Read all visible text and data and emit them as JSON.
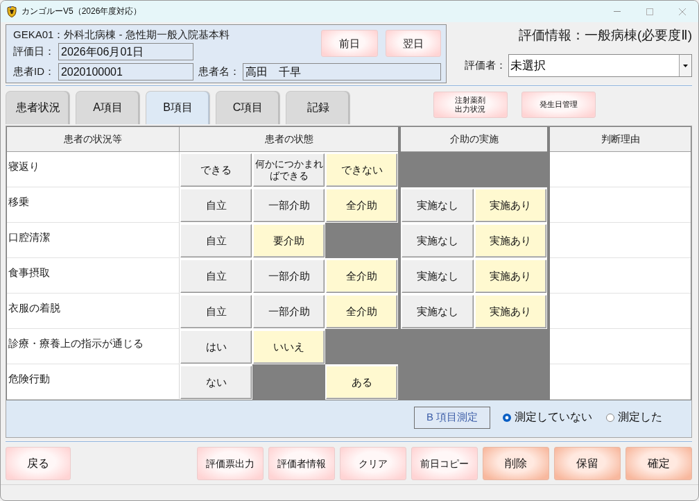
{
  "window": {
    "title": "カンゴルーV5（2026年度対応）"
  },
  "header": {
    "ward": "GEKA01：外科北病棟 - 急性期一般入院基本料",
    "evaluation_date": {
      "label": "評価日：",
      "value": "2026年06月01日"
    },
    "patient_id": {
      "label": "患者ID：",
      "value": "2020100001"
    },
    "patient_name": {
      "label": "患者名：",
      "value": "高田　千早"
    },
    "day_buttons": [
      "前日",
      "翌日"
    ]
  },
  "evaluation_info": {
    "title": "評価情報：一般病棟(必要度Ⅱ)",
    "evaluator_label": "評価者：",
    "evaluator_value": "未選択"
  },
  "tabs": [
    {
      "label": "患者状況",
      "selected": false
    },
    {
      "label": "A項目",
      "selected": false
    },
    {
      "label": "B項目",
      "selected": true
    },
    {
      "label": "C項目",
      "selected": false
    },
    {
      "label": "記録",
      "selected": false
    }
  ],
  "tool_buttons": [
    "注射薬剤出力状況",
    "発生日管理"
  ],
  "table": {
    "columns": [
      "患者の状況等",
      "患者の状態",
      "介助の実施",
      "判断理由"
    ],
    "rows": [
      {
        "item": "寝返り",
        "states": [
          {
            "kind": "option",
            "label": "できる",
            "selected": false
          },
          {
            "kind": "option",
            "label": "何かにつかまればできる",
            "selected": false
          },
          {
            "kind": "option",
            "label": "できない",
            "selected": true
          }
        ]
      },
      {
        "item": "移乗",
        "states": [
          {
            "kind": "option",
            "label": "自立",
            "selected": false
          },
          {
            "kind": "option",
            "label": "一部介助",
            "selected": false
          },
          {
            "kind": "option",
            "label": "全介助",
            "selected": true
          }
        ],
        "assistance": [
          {
            "label": "実施なし",
            "selected": false
          },
          {
            "label": "実施あり",
            "selected": true
          }
        ]
      },
      {
        "item": "口腔清潔",
        "states": [
          {
            "kind": "option",
            "label": "自立",
            "selected": false
          },
          {
            "kind": "option",
            "label": "要介助",
            "selected": true
          },
          {
            "kind": "blank"
          }
        ],
        "assistance": [
          {
            "label": "実施なし",
            "selected": false
          },
          {
            "label": "実施あり",
            "selected": true
          }
        ]
      },
      {
        "item": "食事摂取",
        "states": [
          {
            "kind": "option",
            "label": "自立",
            "selected": false
          },
          {
            "kind": "option",
            "label": "一部介助",
            "selected": false
          },
          {
            "kind": "option",
            "label": "全介助",
            "selected": true
          }
        ],
        "assistance": [
          {
            "label": "実施なし",
            "selected": false
          },
          {
            "label": "実施あり",
            "selected": true
          }
        ]
      },
      {
        "item": "衣服の着脱",
        "states": [
          {
            "kind": "option",
            "label": "自立",
            "selected": false
          },
          {
            "kind": "option",
            "label": "一部介助",
            "selected": false
          },
          {
            "kind": "option",
            "label": "全介助",
            "selected": true
          }
        ],
        "assistance": [
          {
            "label": "実施なし",
            "selected": false
          },
          {
            "label": "実施あり",
            "selected": true
          }
        ]
      },
      {
        "item": "診療・療養上の指示が通じる",
        "states": [
          {
            "kind": "option",
            "label": "はい",
            "selected": false
          },
          {
            "kind": "option",
            "label": "いいえ",
            "selected": true
          },
          {
            "kind": "blank"
          }
        ]
      },
      {
        "item": "危険行動",
        "states": [
          {
            "kind": "option",
            "label": "ない",
            "selected": false
          },
          {
            "kind": "blank"
          },
          {
            "kind": "option",
            "label": "ある",
            "selected": true
          }
        ]
      }
    ]
  },
  "measurement": {
    "label": "B 項目測定",
    "options": [
      {
        "label": "測定していない",
        "selected": true
      },
      {
        "label": "測定した",
        "selected": false
      }
    ]
  },
  "footer": {
    "back_button": "戻る",
    "actions": [
      {
        "label": "評価票出力",
        "kind": "default"
      },
      {
        "label": "評価者情報",
        "kind": "default"
      },
      {
        "label": "クリア",
        "kind": "default"
      },
      {
        "label": "前日コピー",
        "kind": "default"
      },
      {
        "label": "削除",
        "kind": "accent"
      },
      {
        "label": "保留",
        "kind": "accent"
      },
      {
        "label": "確定",
        "kind": "accent"
      }
    ]
  }
}
